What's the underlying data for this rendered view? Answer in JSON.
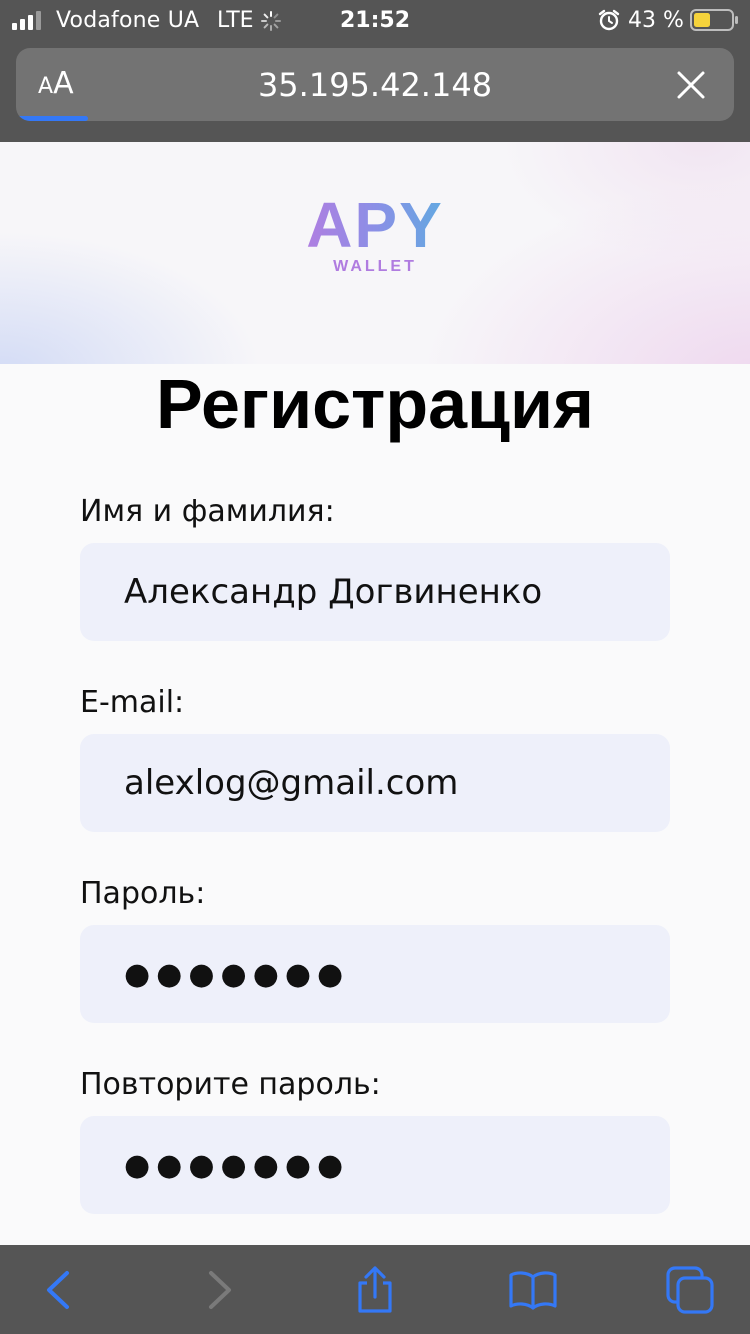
{
  "status_bar": {
    "carrier": "Vodafone UA",
    "network": "LTE",
    "time": "21:52",
    "battery_percent": "43 %",
    "icons": [
      "signal-bars-icon",
      "activity-spinner-icon",
      "alarm-clock-icon",
      "battery-icon"
    ]
  },
  "browser": {
    "text_size_small": "A",
    "text_size_big": "A",
    "url": "35.195.42.148",
    "load_progress": 0.1,
    "close_icon": "close-icon",
    "toolbar_icons": [
      "back-arrow-icon",
      "forward-arrow-icon",
      "share-icon",
      "bookmarks-icon",
      "tabs-icon"
    ]
  },
  "page": {
    "logo_main": "APY",
    "logo_sub": "WALLET",
    "title": "Регистрация",
    "form": {
      "name_label": "Имя и фамилия:",
      "name_value": "Александр Догвиненко",
      "email_label": "E-mail:",
      "email_value": "alexlog@gmail.com",
      "password_label": "Пароль:",
      "password_value": "●●●●●●●",
      "repeat_password_label": "Повторите пароль:",
      "repeat_password_value": "●●●●●●●"
    }
  },
  "colors": {
    "chrome_gray": "#555555",
    "url_bar": "#737373",
    "accent_blue": "#3478f6",
    "input_bg": "#eef0fa",
    "logo_purple": "#b77be0",
    "logo_blue": "#5aaee0"
  }
}
